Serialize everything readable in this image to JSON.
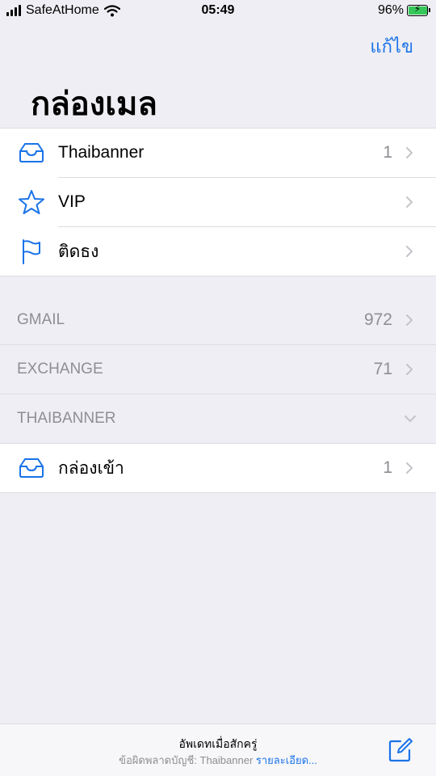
{
  "status_bar": {
    "carrier": "SafeAtHome",
    "time": "05:49",
    "battery": "96%",
    "battery_level": 0.96
  },
  "nav": {
    "edit_label": "แก้ไข",
    "title": "กล่องเมล"
  },
  "mailboxes": [
    {
      "label": "Thaibanner",
      "count": "1",
      "icon": "inbox-tray-icon"
    },
    {
      "label": "VIP",
      "count": "",
      "icon": "star-icon"
    },
    {
      "label": "ติดธง",
      "count": "",
      "icon": "flag-icon"
    }
  ],
  "accounts": [
    {
      "label": "GMAIL",
      "count": "972"
    },
    {
      "label": "EXCHANGE",
      "count": "71"
    },
    {
      "label": "THAIBANNER",
      "count": ""
    }
  ],
  "thaibanner_inbox": {
    "label": "กล่องเข้า",
    "count": "1",
    "icon": "inbox-tray-icon"
  },
  "toolbar": {
    "status_title": "อัพเดทเมื่อสักครู่",
    "error_prefix": "ข้อผิดพลาดบัญชี: Thaibanner ",
    "details_link": "รายละเอียด...",
    "compose_icon": "compose-icon"
  },
  "colors": {
    "accent": "#1a73e8",
    "background": "#efeef4",
    "secondary_text": "#8e8e93"
  }
}
